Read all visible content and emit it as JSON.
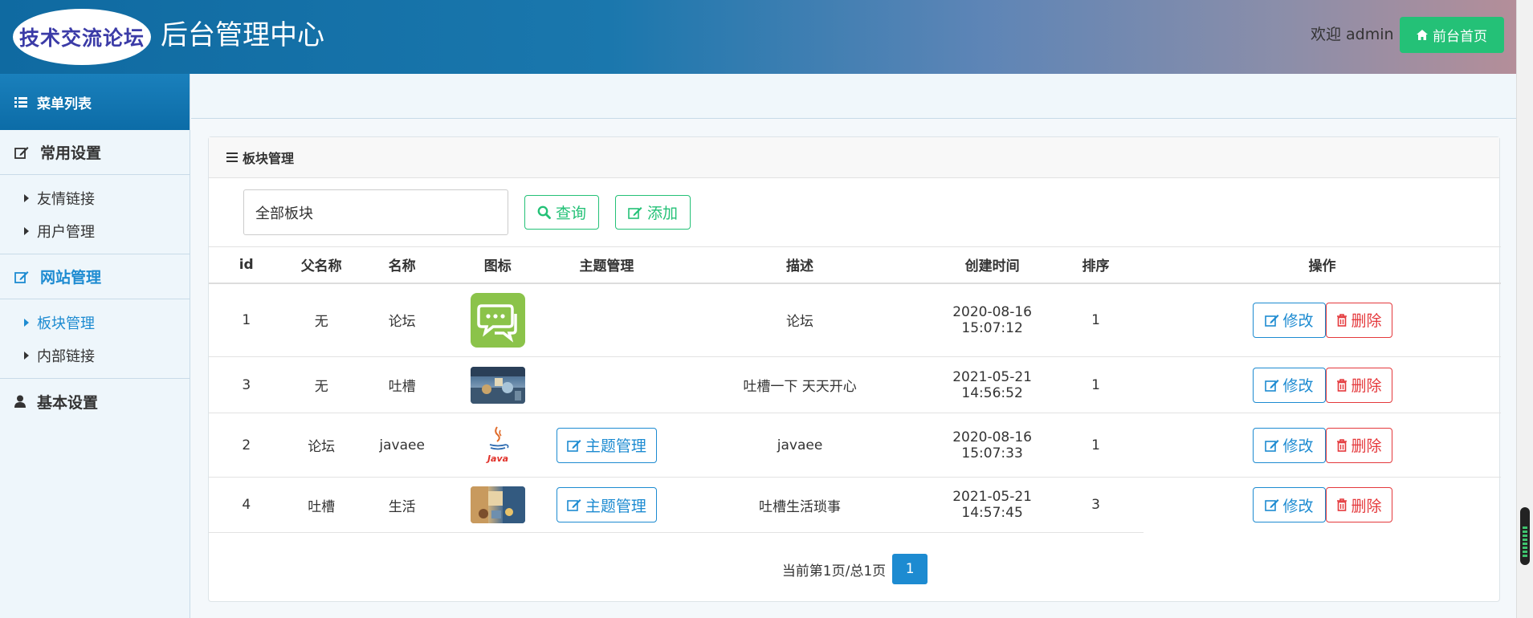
{
  "header": {
    "logo_text": "技术交流论坛",
    "title": "后台管理中心",
    "welcome": "欢迎 admin",
    "home_button": "前台首页"
  },
  "sidebar": {
    "menu_title": "菜单列表",
    "groups": [
      {
        "label": "常用设置",
        "items": [
          "友情链接",
          "用户管理"
        ]
      },
      {
        "label": "网站管理",
        "items": [
          "板块管理",
          "内部链接"
        ],
        "active": true
      },
      {
        "label": "基本设置",
        "items": []
      }
    ]
  },
  "panel": {
    "title": "板块管理",
    "select_value": "全部板块",
    "query_button": "查询",
    "add_button": "添加"
  },
  "table": {
    "headers": [
      "id",
      "父名称",
      "名称",
      "图标",
      "主题管理",
      "描述",
      "创建时间",
      "排序",
      "操作"
    ],
    "rows": [
      {
        "id": "1",
        "parent": "无",
        "name": "论坛",
        "icon": "chat-bubble-icon",
        "topic_btn": "",
        "desc": "论坛",
        "date": "2020-08-16",
        "time": "15:07:12",
        "sort": "1"
      },
      {
        "id": "3",
        "parent": "无",
        "name": "吐槽",
        "icon": "scene-photo",
        "topic_btn": "",
        "desc": "吐槽一下 天天开心",
        "date": "2021-05-21",
        "time": "14:56:52",
        "sort": "1"
      },
      {
        "id": "2",
        "parent": "论坛",
        "name": "javaee",
        "icon": "java-logo",
        "topic_btn": "主题管理",
        "desc": "javaee",
        "date": "2020-08-16",
        "time": "15:07:33",
        "sort": "1"
      },
      {
        "id": "4",
        "parent": "吐槽",
        "name": "生活",
        "icon": "cafe-photo",
        "topic_btn": "主题管理",
        "desc": "吐槽生活琐事",
        "date": "2021-05-21",
        "time": "14:57:45",
        "sort": "3"
      }
    ],
    "edit_label": "修改",
    "delete_label": "删除"
  },
  "pager": {
    "info": "当前第1页/总1页",
    "current": "1"
  },
  "colors": {
    "primary": "#1d8bd1",
    "success": "#24c177",
    "danger": "#e4393c"
  }
}
